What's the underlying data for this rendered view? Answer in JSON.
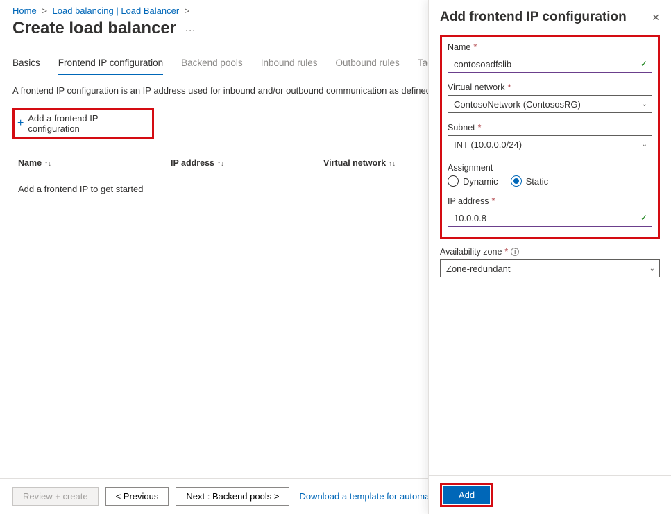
{
  "breadcrumb": {
    "home": "Home",
    "lb_list": "Load balancing | Load Balancer"
  },
  "page": {
    "title": "Create load balancer"
  },
  "tabs": {
    "basics": "Basics",
    "frontend": "Frontend IP configuration",
    "backend": "Backend pools",
    "inbound": "Inbound rules",
    "outbound": "Outbound rules",
    "tags": "Tags"
  },
  "description": "A frontend IP configuration is an IP address used for inbound and/or outbound communication as defined withi",
  "add_config_btn": "Add a frontend IP configuration",
  "table": {
    "col_name": "Name",
    "col_ip": "IP address",
    "col_vnet": "Virtual network",
    "empty": "Add a frontend IP to get started"
  },
  "bottom": {
    "review": "Review + create",
    "prev": "< Previous",
    "next": "Next : Backend pools >",
    "download": "Download a template for automati"
  },
  "panel": {
    "title": "Add frontend IP configuration",
    "labels": {
      "name": "Name",
      "vnet": "Virtual network",
      "subnet": "Subnet",
      "assignment": "Assignment",
      "ip": "IP address",
      "az": "Availability zone"
    },
    "values": {
      "name": "contosoadfslib",
      "vnet": "ContosoNetwork (ContososRG)",
      "subnet": "INT (10.0.0.0/24)",
      "dynamic": "Dynamic",
      "static": "Static",
      "ip": "10.0.0.8",
      "az": "Zone-redundant"
    },
    "add_btn": "Add"
  }
}
